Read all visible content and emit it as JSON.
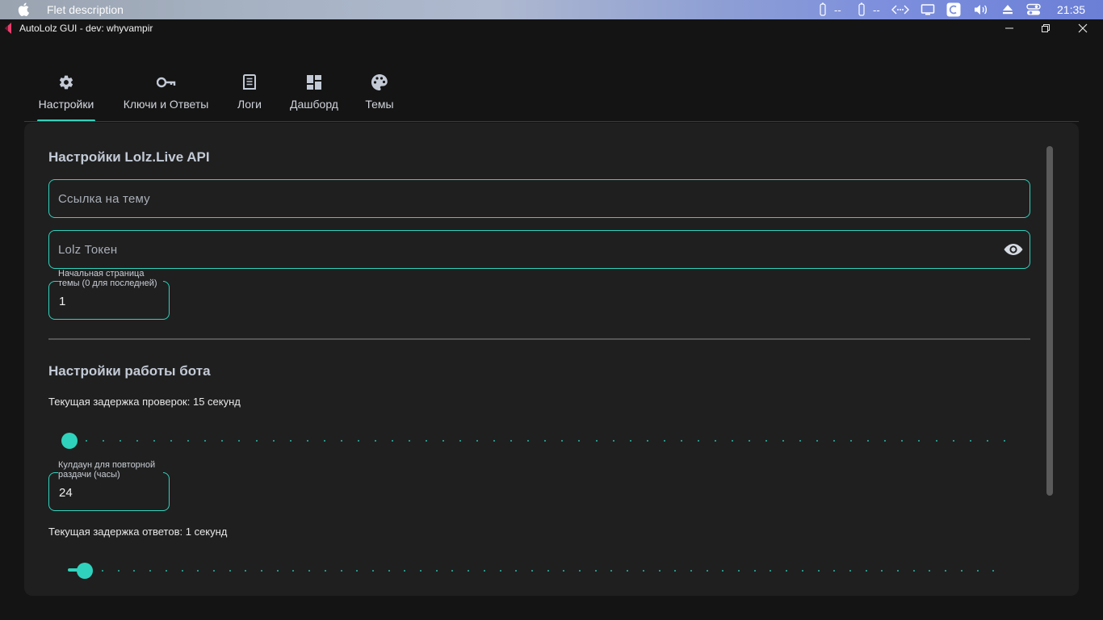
{
  "menubar": {
    "app_name": "Flet description",
    "tray_dash_1": "--",
    "tray_dash_2": "--",
    "clock": "21:35",
    "icons": [
      "apple-icon",
      "battery-icon",
      "battery-icon",
      "network-icon",
      "display-icon",
      "c-app-icon",
      "volume-icon",
      "eject-icon",
      "control-center-icon"
    ]
  },
  "window": {
    "title": "AutoLolz GUI - dev: whyvampir",
    "controls": [
      "minimize-icon",
      "restore-icon",
      "close-icon"
    ]
  },
  "tabs": [
    {
      "label": "Настройки",
      "icon": "gear-icon",
      "active": true
    },
    {
      "label": "Ключи и Ответы",
      "icon": "key-icon",
      "active": false
    },
    {
      "label": "Логи",
      "icon": "log-icon",
      "active": false
    },
    {
      "label": "Дашборд",
      "icon": "dashboard-icon",
      "active": false
    },
    {
      "label": "Темы",
      "icon": "palette-icon",
      "active": false
    }
  ],
  "api_section": {
    "title": "Настройки Lolz.Live API",
    "topic_link_placeholder": "Ссылка на тему",
    "token_placeholder": "Lolz Токен",
    "start_page_label": "Начальная страница темы (0 для последней)",
    "start_page_value": "1"
  },
  "bot_section": {
    "title": "Настройки работы бота",
    "check_delay_text": "Текущая задержка проверок: 15 секунд",
    "cooldown_label": "Кулдаун для повторной раздачи (часы)",
    "cooldown_value": "24",
    "reply_delay_text": "Текущая задержка ответов: 1 секунд"
  },
  "colors": {
    "accent": "#2fd3bd",
    "background": "#141414",
    "card": "#1f1f1f"
  }
}
